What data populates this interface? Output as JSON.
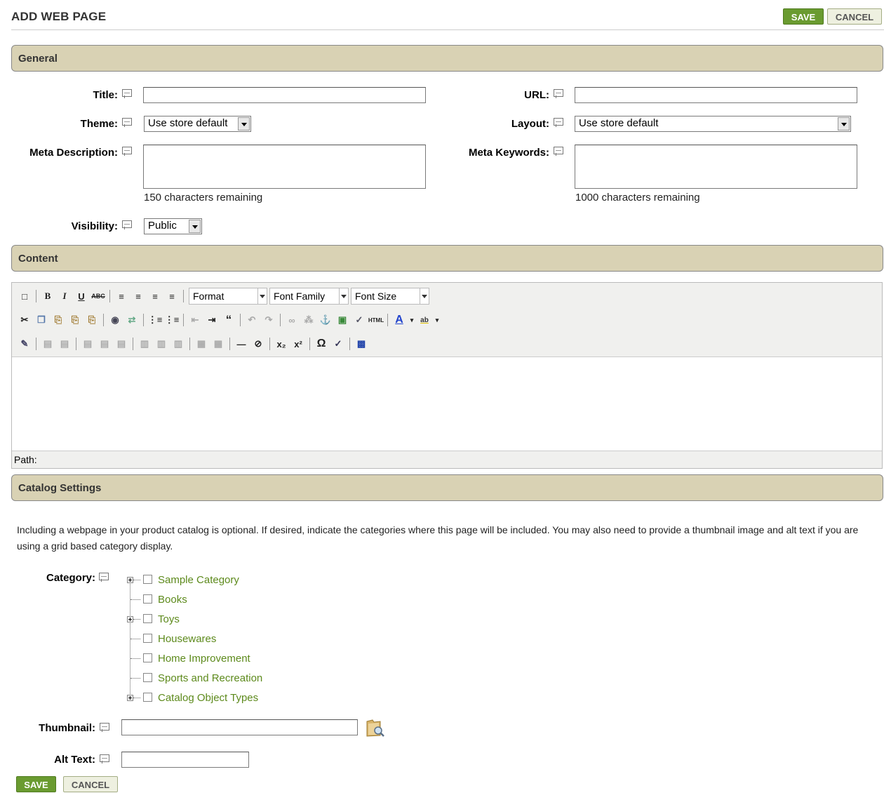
{
  "page": {
    "title": "ADD WEB PAGE"
  },
  "actions": {
    "save_label": "SAVE",
    "cancel_label": "CANCEL"
  },
  "general": {
    "header": "General",
    "title_label": "Title:",
    "title_value": "",
    "url_label": "URL:",
    "url_value": "",
    "theme_label": "Theme:",
    "theme_value": "Use store default",
    "layout_label": "Layout:",
    "layout_value": "Use store default",
    "meta_description_label": "Meta Description:",
    "meta_description_remaining": "150 characters remaining",
    "meta_keywords_label": "Meta Keywords:",
    "meta_keywords_remaining": "1000 characters remaining",
    "visibility_label": "Visibility:",
    "visibility_value": "Public"
  },
  "content": {
    "header": "Content",
    "format_label": "Format",
    "font_family_label": "Font Family",
    "font_size_label": "Font Size",
    "path_label": "Path:"
  },
  "catalog": {
    "header": "Catalog Settings",
    "description": "Including a webpage in your product catalog is optional. If desired, indicate the categories where this page will be included. You may also need to provide a thumbnail image and alt text if you are using a grid based category display.",
    "category_label": "Category:",
    "categories": [
      {
        "label": "Sample Category",
        "expandable": true,
        "checked": false
      },
      {
        "label": "Books",
        "expandable": false,
        "checked": false
      },
      {
        "label": "Toys",
        "expandable": true,
        "checked": false
      },
      {
        "label": "Housewares",
        "expandable": false,
        "checked": false
      },
      {
        "label": "Home Improvement",
        "expandable": false,
        "checked": false
      },
      {
        "label": "Sports and Recreation",
        "expandable": false,
        "checked": false
      },
      {
        "label": "Catalog Object Types",
        "expandable": true,
        "checked": false
      }
    ],
    "thumbnail_label": "Thumbnail:",
    "alt_text_label": "Alt Text:"
  },
  "colors": {
    "section_header_bg": "#d9d2b4",
    "save_button": "#6a9b30",
    "category_link": "#5d8a1c"
  }
}
